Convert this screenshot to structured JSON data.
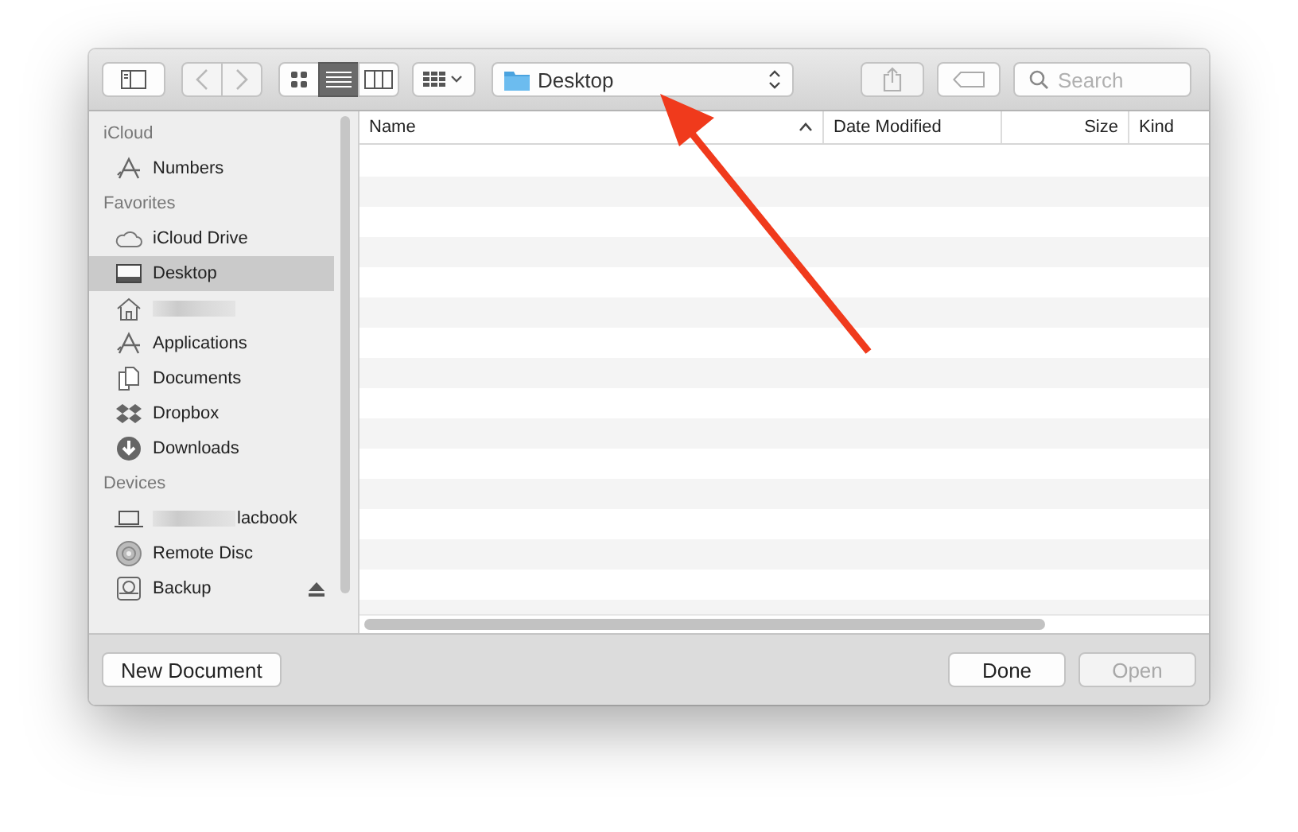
{
  "toolbar": {
    "back": {
      "disabled": true
    },
    "forward": {
      "disabled": true
    },
    "view_modes": [
      {
        "kind": "icon",
        "selected": false
      },
      {
        "kind": "list",
        "selected": true
      },
      {
        "kind": "column",
        "selected": false
      }
    ],
    "location": {
      "label": "Desktop"
    },
    "share": {
      "disabled": true
    },
    "search": {
      "placeholder": "Search"
    }
  },
  "sidebar": {
    "sections": [
      {
        "title": "iCloud",
        "items": [
          {
            "kind": "apps",
            "label": "Numbers",
            "selected": false
          }
        ]
      },
      {
        "title": "Favorites",
        "items": [
          {
            "kind": "cloud",
            "label": "iCloud Drive",
            "selected": false
          },
          {
            "kind": "desktop",
            "label": "Desktop",
            "selected": true
          },
          {
            "kind": "home",
            "redacted": true,
            "selected": false
          },
          {
            "kind": "apps",
            "label": "Applications",
            "selected": false
          },
          {
            "kind": "docs",
            "label": "Documents",
            "selected": false
          },
          {
            "kind": "dropbox",
            "label": "Dropbox",
            "selected": false
          },
          {
            "kind": "download",
            "label": "Downloads",
            "selected": false
          }
        ]
      },
      {
        "title": "Devices",
        "items": [
          {
            "kind": "laptop",
            "redacted": true,
            "label": "lacbook",
            "selected": false
          },
          {
            "kind": "disc",
            "label": "Remote Disc",
            "selected": false
          },
          {
            "kind": "drive",
            "label": "Backup",
            "selected": false,
            "eject": true
          }
        ]
      }
    ]
  },
  "table": {
    "columns": [
      {
        "label": "Name",
        "sorted": true
      },
      {
        "label": "Date Modified",
        "sorted": false
      },
      {
        "label": "Size",
        "sorted": false
      },
      {
        "label": "Kind",
        "sorted": false
      }
    ]
  },
  "buttons": [
    {
      "label": "New Document",
      "disabled": false
    },
    {
      "label": "Done",
      "disabled": false
    },
    {
      "label": "Open",
      "disabled": true
    }
  ]
}
